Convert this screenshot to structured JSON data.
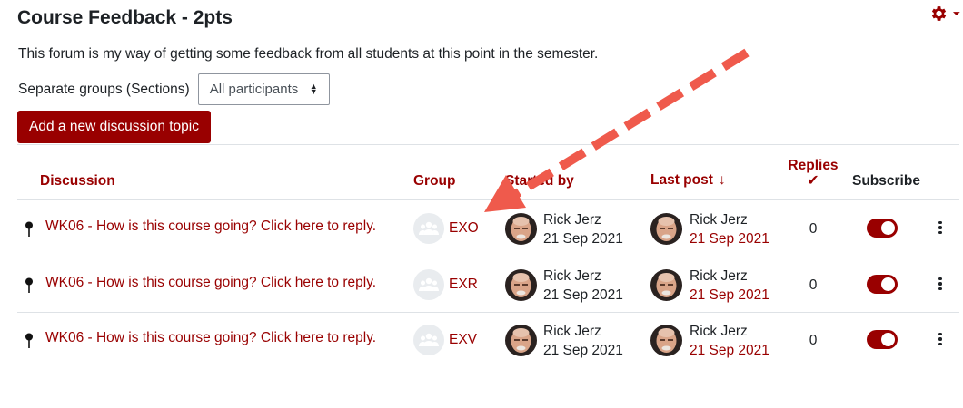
{
  "page": {
    "title": "Course Feedback - 2pts",
    "intro": "This forum is my way of getting some feedback from all students at this point in the semester."
  },
  "groups": {
    "label": "Separate groups (Sections)",
    "selected": "All participants"
  },
  "actions": {
    "add_topic_label": "Add a new discussion topic",
    "settings_icon": "gear-icon"
  },
  "table": {
    "headers": {
      "discussion": "Discussion",
      "group": "Group",
      "started_by": "Started by",
      "last_post": "Last post",
      "replies": "Replies",
      "subscribe": "Subscribe"
    },
    "sort": {
      "column": "last_post",
      "direction": "descending",
      "icon": "arrow-down-icon"
    },
    "rows": [
      {
        "topic": "WK06 - How is this course going? Click here to reply.",
        "group": "EXO",
        "started_by": "Rick Jerz",
        "started_date": "21 Sep 2021",
        "last_post_by": "Rick Jerz",
        "last_post_date": "21 Sep 2021",
        "replies": "0",
        "subscribed": true,
        "pinned": true
      },
      {
        "topic": "WK06 - How is this course going? Click here to reply.",
        "group": "EXR",
        "started_by": "Rick Jerz",
        "started_date": "21 Sep 2021",
        "last_post_by": "Rick Jerz",
        "last_post_date": "21 Sep 2021",
        "replies": "0",
        "subscribed": true,
        "pinned": true
      },
      {
        "topic": "WK06 - How is this course going? Click here to reply.",
        "group": "EXV",
        "started_by": "Rick Jerz",
        "started_date": "21 Sep 2021",
        "last_post_by": "Rick Jerz",
        "last_post_date": "21 Sep 2021",
        "replies": "0",
        "subscribed": true,
        "pinned": true
      }
    ]
  },
  "colors": {
    "brand": "#990000",
    "annotation_arrow": "#ef5a4c",
    "text": "#1d2125",
    "border": "#dee2e6"
  }
}
